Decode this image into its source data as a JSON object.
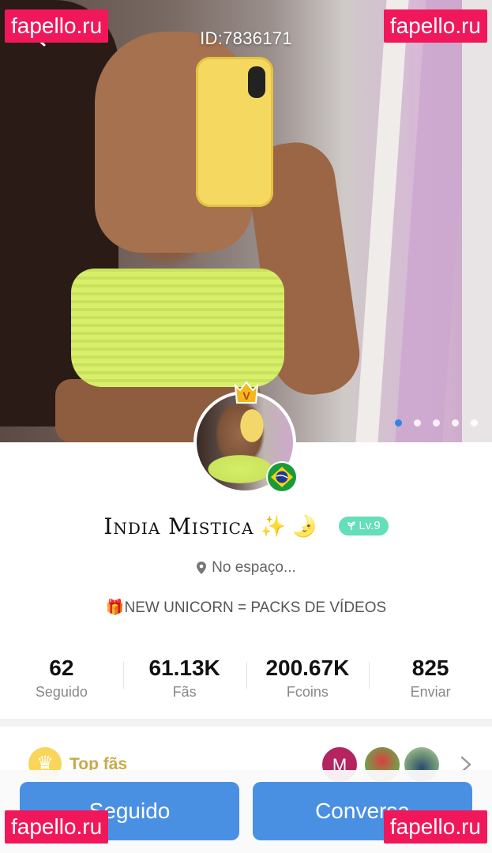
{
  "header": {
    "profile_id": "ID:7836171"
  },
  "watermarks": {
    "top_left": "fapello.ru",
    "top_right": "fapello.ru",
    "bottom_left": "fapello.ru",
    "bottom_right": "fapello.ru"
  },
  "carousel": {
    "count": 5,
    "active_index": 0
  },
  "profile": {
    "name": "India Mistica",
    "name_emoji": "✨ 🌛",
    "level": "Lv.9",
    "location": "No espaço...",
    "bio": "🎁NEW UNICORN = PACKS DE VÍDEOS",
    "crown_badge_letter": "V"
  },
  "stats": [
    {
      "value": "62",
      "label": "Seguido"
    },
    {
      "value": "61.13K",
      "label": "Fãs"
    },
    {
      "value": "200.67K",
      "label": "Fcoins"
    },
    {
      "value": "825",
      "label": "Enviar"
    }
  ],
  "top_fans": {
    "label": "Top fãs",
    "first_fan_initial": "M"
  },
  "actions": {
    "follow_label": "Seguido",
    "chat_label": "Conversa"
  },
  "colors": {
    "accent": "#4a90e2",
    "level_badge": "#63dfb9",
    "watermark": "#f0185a",
    "top_fans_gold": "#caa84a"
  }
}
